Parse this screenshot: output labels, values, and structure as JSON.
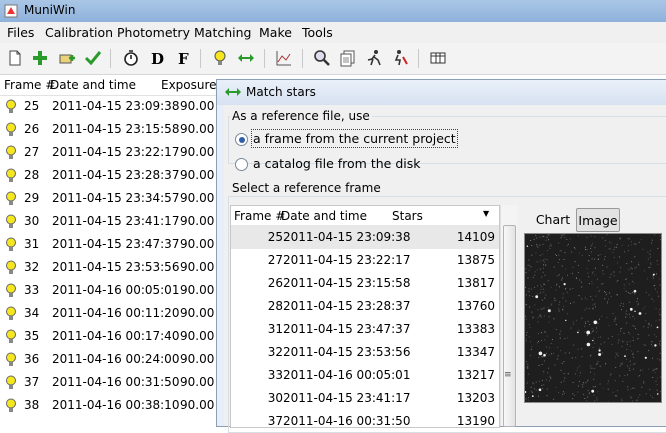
{
  "app": {
    "title": "MuniWin"
  },
  "menu": [
    "Files",
    "Calibration",
    "Photometry",
    "Matching",
    "Make",
    "Tools"
  ],
  "frames_list": {
    "headers": [
      "Frame #",
      "Date and time",
      "Exposure"
    ],
    "rows": [
      {
        "frame": "25",
        "datetime": "2011-04-15 23:09:38",
        "exposure": "90.00"
      },
      {
        "frame": "26",
        "datetime": "2011-04-15 23:15:58",
        "exposure": "90.00"
      },
      {
        "frame": "27",
        "datetime": "2011-04-15 23:22:17",
        "exposure": "90.00"
      },
      {
        "frame": "28",
        "datetime": "2011-04-15 23:28:37",
        "exposure": "90.00"
      },
      {
        "frame": "29",
        "datetime": "2011-04-15 23:34:57",
        "exposure": "90.00"
      },
      {
        "frame": "30",
        "datetime": "2011-04-15 23:41:17",
        "exposure": "90.00"
      },
      {
        "frame": "31",
        "datetime": "2011-04-15 23:47:37",
        "exposure": "90.00"
      },
      {
        "frame": "32",
        "datetime": "2011-04-15 23:53:56",
        "exposure": "90.00"
      },
      {
        "frame": "33",
        "datetime": "2011-04-16 00:05:01",
        "exposure": "90.00"
      },
      {
        "frame": "34",
        "datetime": "2011-04-16 00:11:20",
        "exposure": "90.00"
      },
      {
        "frame": "35",
        "datetime": "2011-04-16 00:17:40",
        "exposure": "90.00"
      },
      {
        "frame": "36",
        "datetime": "2011-04-16 00:24:00",
        "exposure": "90.00"
      },
      {
        "frame": "37",
        "datetime": "2011-04-16 00:31:50",
        "exposure": "90.00"
      },
      {
        "frame": "38",
        "datetime": "2011-04-16 00:38:10",
        "exposure": "90.00"
      }
    ]
  },
  "dialog": {
    "title": "Match stars",
    "reference_group_label": "As a reference file, use",
    "option_frame": "a frame from the current project",
    "option_catalog": "a catalog file from the disk",
    "select_label": "Select a reference frame",
    "table_headers": [
      "Frame #",
      "Date and time",
      "Stars"
    ],
    "rows": [
      {
        "frame": "25",
        "datetime": "2011-04-15 23:09:38",
        "stars": "14109"
      },
      {
        "frame": "27",
        "datetime": "2011-04-15 23:22:17",
        "stars": "13875"
      },
      {
        "frame": "26",
        "datetime": "2011-04-15 23:15:58",
        "stars": "13817"
      },
      {
        "frame": "28",
        "datetime": "2011-04-15 23:28:37",
        "stars": "13760"
      },
      {
        "frame": "31",
        "datetime": "2011-04-15 23:47:37",
        "stars": "13383"
      },
      {
        "frame": "32",
        "datetime": "2011-04-15 23:53:56",
        "stars": "13347"
      },
      {
        "frame": "33",
        "datetime": "2011-04-16 00:05:01",
        "stars": "13217"
      },
      {
        "frame": "30",
        "datetime": "2011-04-15 23:41:17",
        "stars": "13203"
      },
      {
        "frame": "37",
        "datetime": "2011-04-16 00:31:50",
        "stars": "13190"
      }
    ],
    "tabs": [
      "Chart",
      "Image"
    ],
    "active_tab": "Image"
  },
  "colors": {
    "titlebar": "#a9c6e6",
    "selection": "#e8e8e8",
    "bulb": "#f5e61e"
  }
}
